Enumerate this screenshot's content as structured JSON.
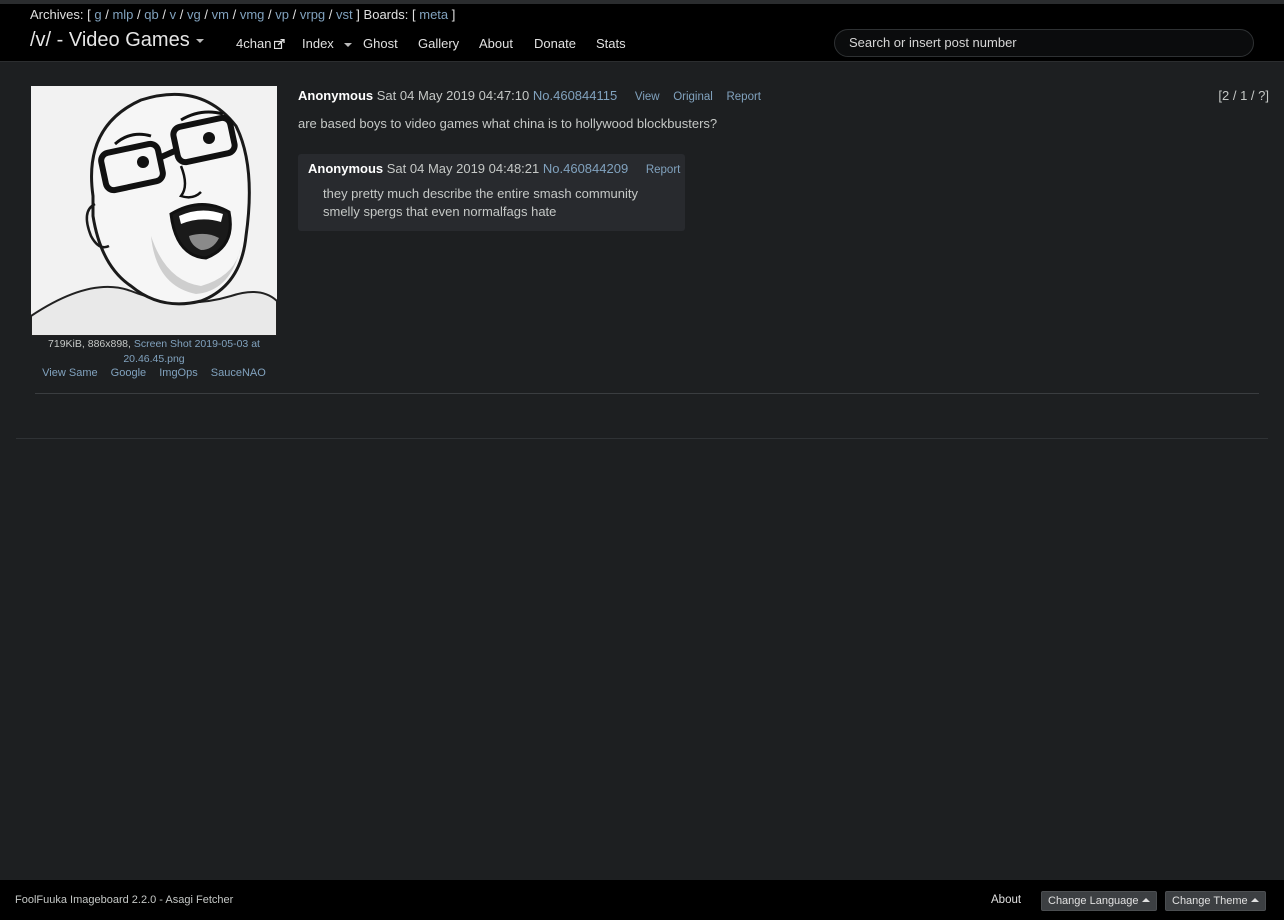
{
  "archives": {
    "label": "Archives:",
    "boards": [
      "g",
      "mlp",
      "qb",
      "v",
      "vg",
      "vm",
      "vmg",
      "vp",
      "vrpg",
      "vst"
    ],
    "boards_label": "Boards:",
    "other_boards": [
      "meta"
    ]
  },
  "header": {
    "board_title": "/v/ - Video Games",
    "nav": {
      "fourchan": "4chan",
      "index": "Index",
      "ghost": "Ghost",
      "gallery": "Gallery",
      "about": "About",
      "donate": "Donate",
      "stats": "Stats"
    },
    "search_placeholder": "Search or insert post number"
  },
  "op": {
    "file_meta": "719KiB, 886x898,",
    "file_name": "Screen Shot 2019-05-03 at 20.46.45.png",
    "file_actions": {
      "view_same": "View Same",
      "google": "Google",
      "imgops": "ImgOps",
      "saucenao": "SauceNAO"
    },
    "name": "Anonymous",
    "date": "Sat 04 May 2019 04:47:10",
    "post_number": "No.460844115",
    "view_label": "View",
    "original_label": "Original",
    "report_label": "Report",
    "text": "are based boys to video games what china is to hollywood blockbusters?",
    "counter": "[2 / 1 / ?]"
  },
  "reply": {
    "name": "Anonymous",
    "date": "Sat 04 May 2019 04:48:21",
    "post_number": "No.460844209",
    "report_label": "Report",
    "line1": "they pretty much describe the entire smash community",
    "line2": "smelly spergs that even normalfags hate"
  },
  "footer": {
    "credit": "FoolFuuka Imageboard 2.2.0 - Asagi Fetcher",
    "about": "About",
    "change_language": "Change Language",
    "change_theme": "Change Theme"
  },
  "colors": {
    "background": "#1d1f21",
    "topbar": "#000000",
    "link": "#81a2be",
    "reply_bg": "#282a2e"
  }
}
